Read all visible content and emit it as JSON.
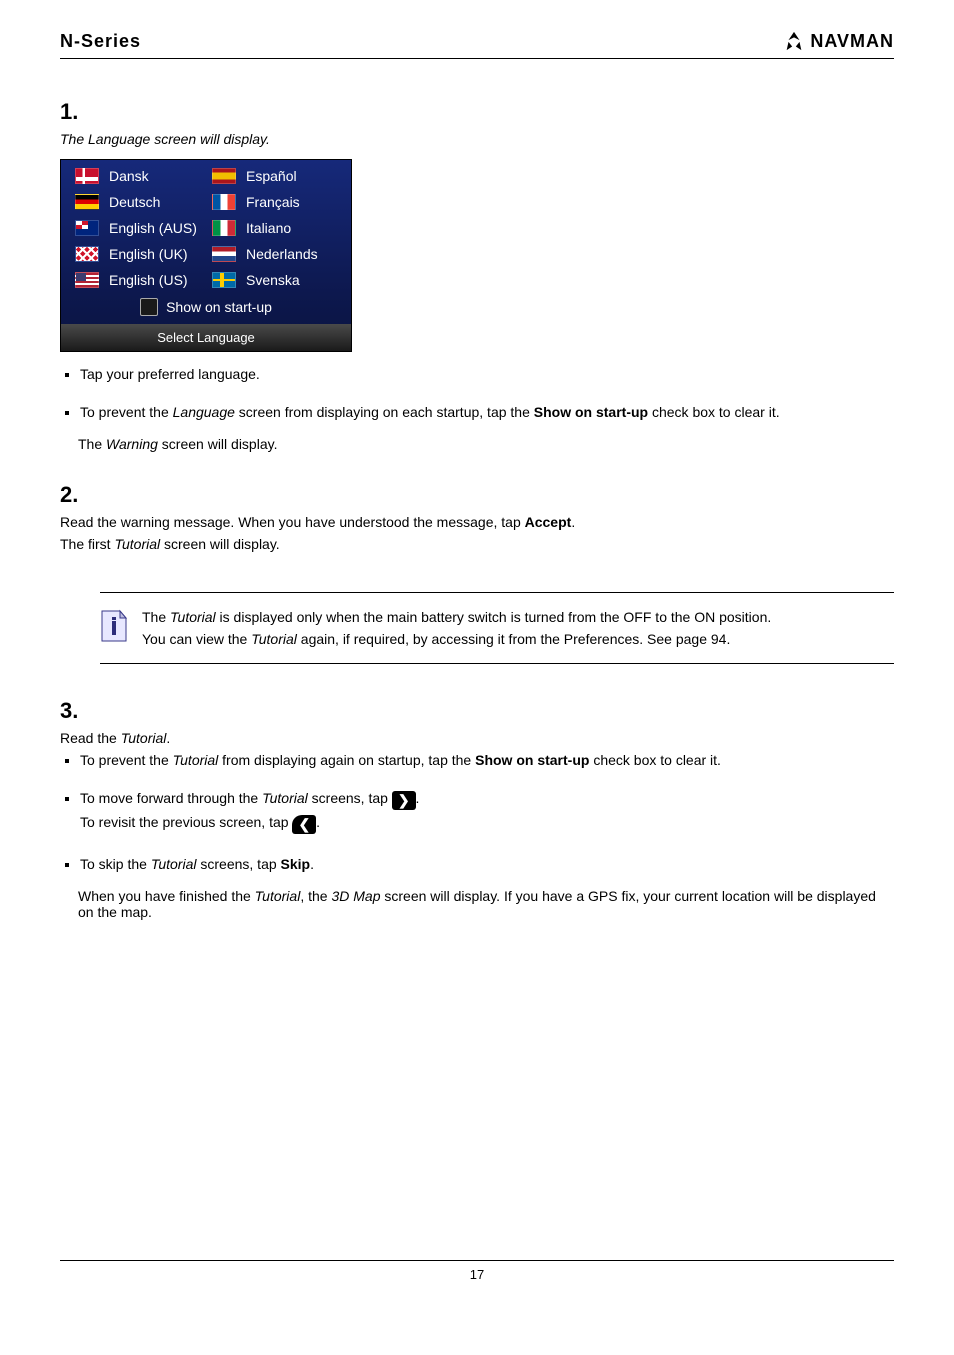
{
  "header": {
    "left": "N-Series",
    "brand": "NAVMAN"
  },
  "step1": {
    "number": "1.",
    "title_prefix": "The ",
    "title_em": "Language",
    "title_suffix": " screen will display.",
    "languages": {
      "dk": "Dansk",
      "de": "Deutsch",
      "au": "English (AUS)",
      "uk": "English (UK)",
      "us": "English (US)",
      "es": "Español",
      "fr": "Français",
      "it": "Italiano",
      "nl": "Nederlands",
      "se": "Svenska"
    },
    "startup_label": "Show on start-up",
    "footer_label": "Select Language",
    "bullet1": "Tap your preferred language.",
    "bullet2_pre": "To prevent the ",
    "bullet2_em": "Language",
    "bullet2_mid": " screen from displaying on each startup, tap the ",
    "bullet2_bold": "Show on start-up",
    "bullet2_suf": " check box to clear it.",
    "result_pre": "The ",
    "result_em1": "Warning",
    "result_suf1": " screen will display."
  },
  "step2": {
    "number": "2.",
    "line_pre": "Read the warning message. When you have understood the message, tap ",
    "line_bold": "Accept",
    "line_suf": ".",
    "result_pre": "The first ",
    "result_em": "Tutorial",
    "result_suf": " screen will display."
  },
  "tip": {
    "line1_pre": "The ",
    "line1_em": "Tutorial",
    "line1_suf": " is displayed only when the main battery switch is turned from the OFF to the ON position.",
    "line2_pre": "You can view the ",
    "line2_em": "Tutorial",
    "line2_suf": " again, if required, by accessing it from the Preferences. See page 94."
  },
  "step3": {
    "number": "3.",
    "line1_pre": "Read the ",
    "line1_em": "Tutorial",
    "line1_suf": ".",
    "b1_pre": "To prevent the ",
    "b1_em": "Tutorial",
    "b1_mid": " from displaying again on startup, tap the ",
    "b1_bold": "Show on start-up",
    "b1_suf": " check box to clear it.",
    "b2_pre": "To move forward through the ",
    "b2_em": "Tutorial",
    "b2_mid1": " screens, tap ",
    "b2_mid2": ".",
    "b2_back_pre": "To revisit the previous screen, tap ",
    "b2_back_suf": ".",
    "b3_pre": "To skip the ",
    "b3_em": "Tutorial",
    "b3_mid": " screens, tap ",
    "b3_bold": "Skip",
    "b3_suf": ".",
    "result1_pre": "When you have finished the ",
    "result1_em": "Tutorial",
    "result1_mid": ", the ",
    "result1_em2": "3D Map",
    "result1_suf": " screen will display. If you have a GPS fix, your current location will be displayed on the map."
  },
  "footer": {
    "page_num": "17"
  }
}
